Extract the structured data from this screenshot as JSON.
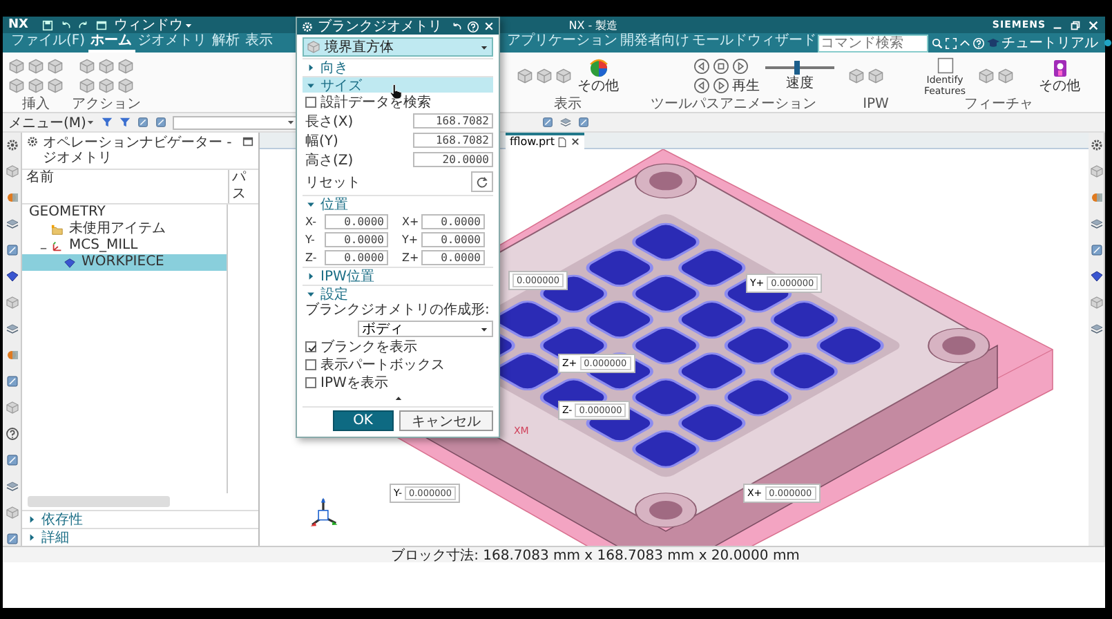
{
  "title_bar": {
    "logo": "NX",
    "window_menu": "ウィンドウ",
    "title": "NX - 製造",
    "brand": "SIEMENS"
  },
  "menu_tabs_left": [
    {
      "label": "ファイル(F)",
      "selected": false
    },
    {
      "label": "ホーム",
      "selected": true
    },
    {
      "label": "ジオメトリ",
      "selected": false
    },
    {
      "label": "解析",
      "selected": false
    },
    {
      "label": "表示",
      "selected": false
    }
  ],
  "menu_tabs_right": [
    {
      "label": "アプリケーション",
      "selected": false
    },
    {
      "label": "開発者向け",
      "selected": false
    },
    {
      "label": "モールドウィザード",
      "selected": false
    }
  ],
  "command_search": {
    "placeholder": "コマンド検索"
  },
  "tutorial": "チュートリアル",
  "ribbon": {
    "left_groups": [
      {
        "label": "挿入"
      },
      {
        "label": "アクション"
      }
    ],
    "right_groups": [
      {
        "label": "表示",
        "buttons": [
          {
            "kind": "palette",
            "label": "その他"
          }
        ]
      },
      {
        "label": "ツールパスアニメーション",
        "buttons": [
          {
            "kind": "play",
            "label": "再生"
          },
          {
            "kind": "slider",
            "label": "速度",
            "level": 0.45
          }
        ]
      },
      {
        "label": "IPW"
      },
      {
        "label": "フィーチャ",
        "buttons": [
          {
            "kind": "identify",
            "label": "Identify Features"
          },
          {
            "kind": "more",
            "label": "その他"
          }
        ]
      }
    ]
  },
  "toolbar": {
    "menu": "メニュー(M)"
  },
  "navigator": {
    "title": "オペレーションナビゲーター - ジオメトリ",
    "columns": [
      "名前",
      "パス"
    ],
    "tree": [
      {
        "label": "GEOMETRY",
        "selected": false,
        "children": [
          {
            "label": "未使用アイテム",
            "kind": "folder",
            "selected": false
          },
          {
            "label": "MCS_MILL",
            "kind": "csys",
            "selected": false,
            "children": [
              {
                "label": "WORKPIECE",
                "kind": "workpiece",
                "selected": true
              }
            ]
          }
        ]
      }
    ],
    "panels": [
      {
        "title": "依存性",
        "expanded": false
      },
      {
        "title": "詳細",
        "expanded": false
      }
    ]
  },
  "viewport": {
    "file_tab": "fflow.prt",
    "csys_label": "XM",
    "handles": [
      {
        "value": "0.000000"
      },
      {
        "axis": "Y+",
        "value": "0.000000"
      },
      {
        "axis": "Z+",
        "value": "0.000000"
      },
      {
        "axis": "Z-",
        "value": "0.000000"
      },
      {
        "axis": "Y-",
        "value": "0.000000"
      },
      {
        "axis": "X+",
        "value": "0.000000"
      }
    ]
  },
  "dialog": {
    "title": "ブランクジオメトリ",
    "type": "境界直方体",
    "sections": [
      {
        "title": "向き",
        "expanded": false,
        "selected": false
      },
      {
        "title": "サイズ",
        "expanded": true,
        "selected": true,
        "check": {
          "label": "設計データを検索",
          "checked": false
        },
        "fields": [
          {
            "label": "長さ(X)",
            "value": "168.7082"
          },
          {
            "label": "幅(Y)",
            "value": "168.7082"
          },
          {
            "label": "高さ(Z)",
            "value": "20.0000"
          }
        ],
        "reset": "リセット"
      },
      {
        "title": "位置",
        "expanded": true,
        "selected": false,
        "positions": [
          {
            "label": "X-",
            "value": "0.0000"
          },
          {
            "label": "X+",
            "value": "0.0000"
          },
          {
            "label": "Y-",
            "value": "0.0000"
          },
          {
            "label": "Y+",
            "value": "0.0000"
          },
          {
            "label": "Z-",
            "value": "0.0000"
          },
          {
            "label": "Z+",
            "value": "0.0000"
          }
        ]
      },
      {
        "title": "IPW位置",
        "expanded": false,
        "selected": false
      },
      {
        "title": "設定",
        "expanded": true,
        "selected": false,
        "shape": {
          "label": "ブランクジオメトリの作成形:",
          "value": "ボディ"
        },
        "checks": [
          {
            "label": "ブランクを表示",
            "checked": true
          },
          {
            "label": "表示パートボックス",
            "checked": false
          },
          {
            "label": "IPWを表示",
            "checked": false
          }
        ]
      }
    ],
    "buttons": [
      {
        "label": "OK",
        "primary": true
      },
      {
        "label": "キャンセル",
        "primary": false
      }
    ]
  },
  "status_bar": "ブロック寸法: 168.7083 mm x 168.7083 mm x 20.0000 mm"
}
